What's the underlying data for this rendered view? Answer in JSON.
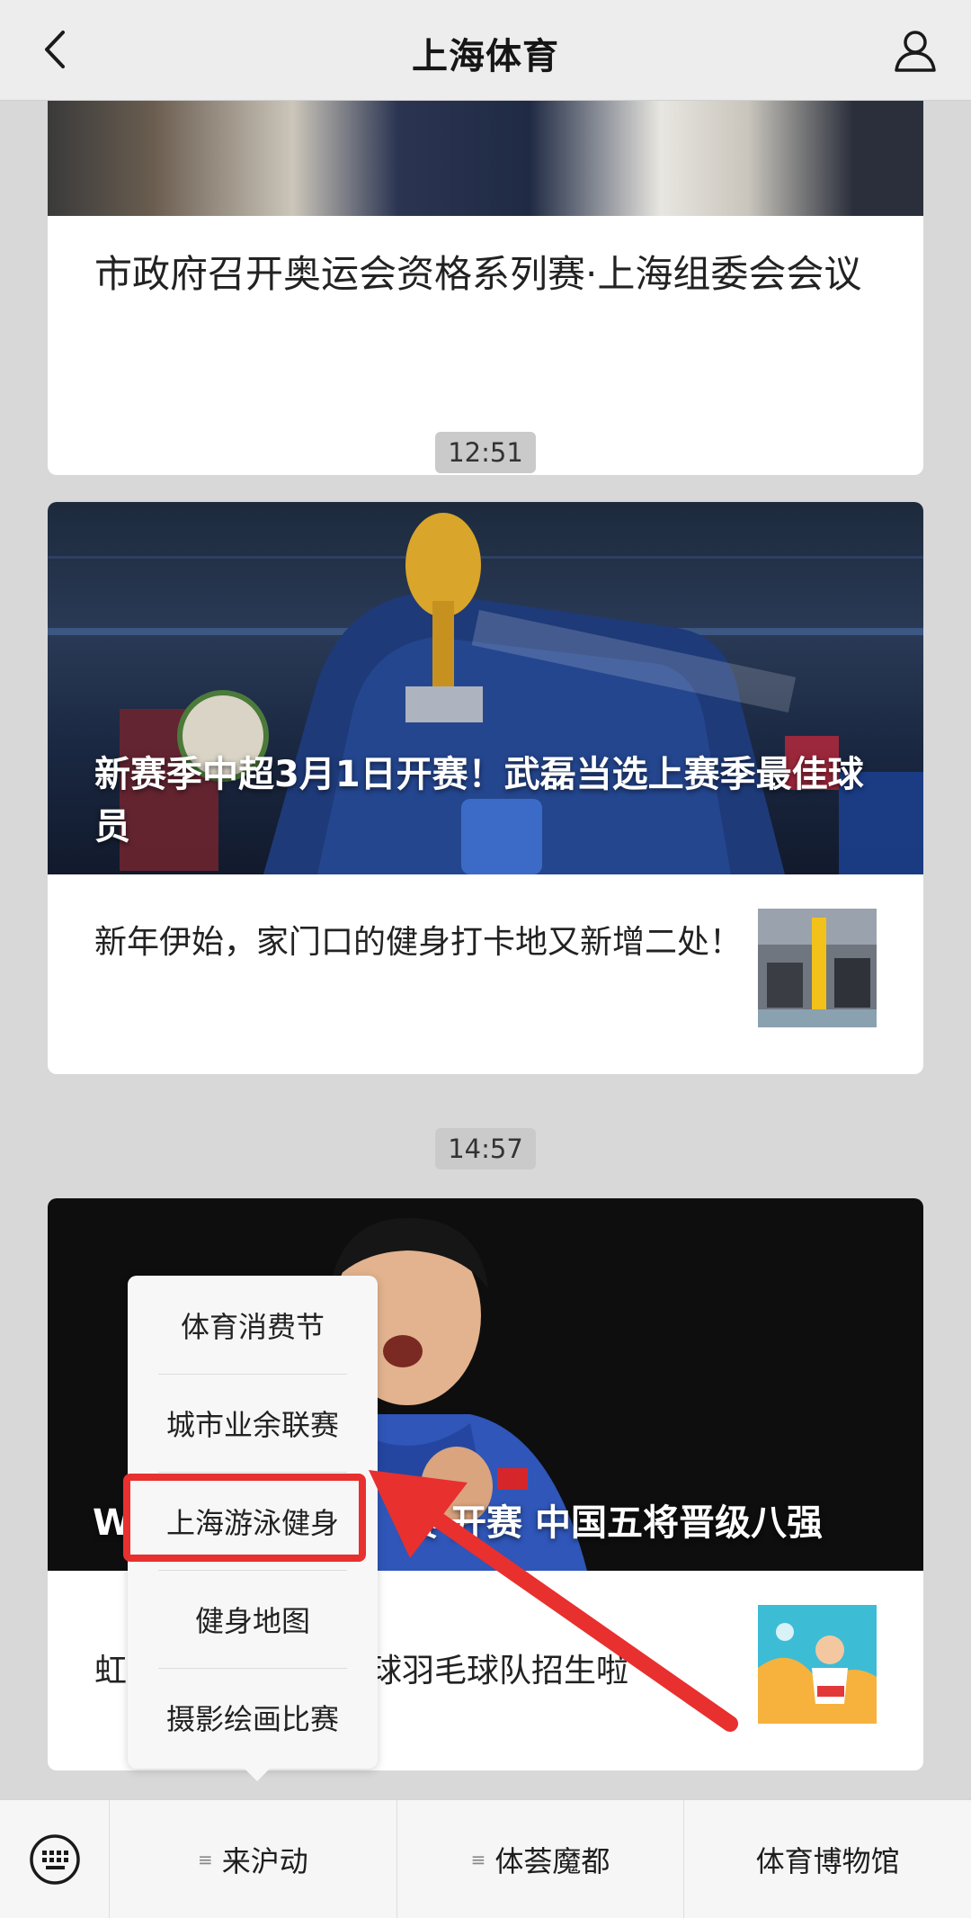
{
  "header": {
    "title": "上海体育",
    "back_icon": "chevron-left-icon",
    "profile_icon": "person-icon"
  },
  "feed": {
    "card1": {
      "headline": "市政府召开奥运会资格系列赛·上海组委会会议"
    },
    "timestamp1": "12:51",
    "card2": {
      "hero_title": "新赛季中超3月1日开赛！武磊当选上赛季最佳球员",
      "sub_title": "新年伊始，家门口的健身打卡地又新增二处！"
    },
    "timestamp2": "14:57",
    "card3": {
      "hero_title_start": "W",
      "hero_title_end": "赛 开赛 中国五将晋级八强",
      "sub_title_start": "虹",
      "sub_title_end": "球羽毛球队招生啦"
    }
  },
  "popup_menu": {
    "items": [
      "体育消费节",
      "城市业余联赛",
      "上海游泳健身",
      "健身地图",
      "摄影绘画比赛"
    ],
    "highlighted_index": 2
  },
  "bottom_bar": {
    "keyboard_icon": "keyboard-icon",
    "tabs": [
      "来沪动",
      "体荟魔都",
      "体育博物馆"
    ],
    "menu_marker": "≡"
  },
  "colors": {
    "accent_red": "#e8302f",
    "background": "#d8d8d8",
    "header": "#ededed"
  }
}
